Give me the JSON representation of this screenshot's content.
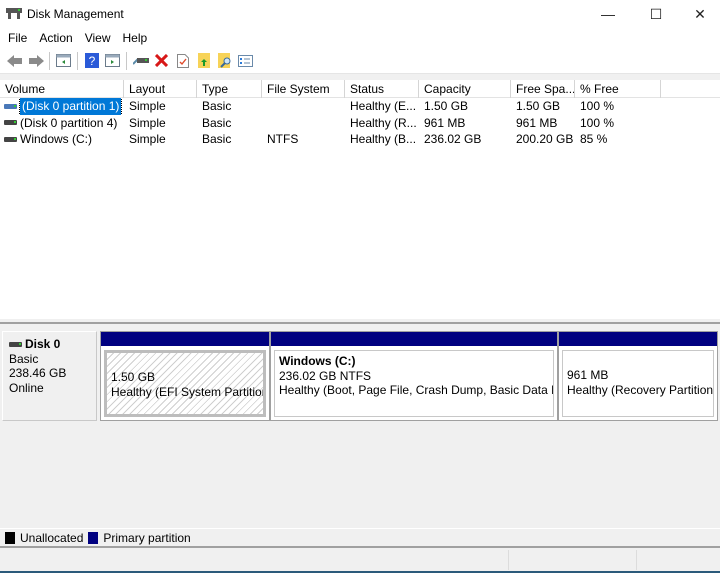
{
  "window": {
    "title": "Disk Management",
    "app_icon": "disk-management-icon",
    "controls": {
      "minimize": "—",
      "maximize": "☐",
      "close": "✕"
    }
  },
  "menu": [
    "File",
    "Action",
    "View",
    "Help"
  ],
  "toolbar": [
    {
      "icon": "back-arrow-icon"
    },
    {
      "icon": "forward-arrow-icon"
    },
    {
      "sep": true
    },
    {
      "icon": "show-hide-console-tree-icon"
    },
    {
      "sep": true
    },
    {
      "icon": "help-icon"
    },
    {
      "icon": "show-hide-action-pane-icon"
    },
    {
      "sep": true
    },
    {
      "icon": "connect-disk-icon"
    },
    {
      "icon": "delete-icon"
    },
    {
      "icon": "properties-check-icon"
    },
    {
      "icon": "open-folder-up-icon"
    },
    {
      "icon": "explore-folder-icon"
    },
    {
      "icon": "settings-list-icon"
    }
  ],
  "volume_list": {
    "columns": [
      "Volume",
      "Layout",
      "Type",
      "File System",
      "Status",
      "Capacity",
      "Free Spa...",
      "% Free"
    ],
    "rows": [
      {
        "volume": "(Disk 0 partition 1)",
        "layout": "Simple",
        "type": "Basic",
        "fs": "",
        "status": "Healthy (E...",
        "capacity": "1.50 GB",
        "free": "1.50 GB",
        "pct": "100 %",
        "selected": true
      },
      {
        "volume": "(Disk 0 partition 4)",
        "layout": "Simple",
        "type": "Basic",
        "fs": "",
        "status": "Healthy (R...",
        "capacity": "961 MB",
        "free": "961 MB",
        "pct": "100 %",
        "selected": false
      },
      {
        "volume": "Windows (C:)",
        "layout": "Simple",
        "type": "Basic",
        "fs": "NTFS",
        "status": "Healthy (B...",
        "capacity": "236.02 GB",
        "free": "200.20 GB",
        "pct": "85 %",
        "selected": false
      }
    ]
  },
  "disks": [
    {
      "name": "Disk 0",
      "type": "Basic",
      "size": "238.46 GB",
      "state": "Online",
      "partitions": [
        {
          "title": "",
          "size": "1.50 GB",
          "status": "Healthy (EFI System Partition)",
          "selected": true
        },
        {
          "title": "Windows  (C:)",
          "size": "236.02 GB NTFS",
          "status": "Healthy (Boot, Page File, Crash Dump, Basic Data Part",
          "selected": false
        },
        {
          "title": "",
          "size": "961 MB",
          "status": "Healthy (Recovery Partition)",
          "selected": false
        }
      ]
    }
  ],
  "legend": [
    {
      "label": "Unallocated",
      "color": "#000000"
    },
    {
      "label": "Primary partition",
      "color": "#000080"
    }
  ]
}
